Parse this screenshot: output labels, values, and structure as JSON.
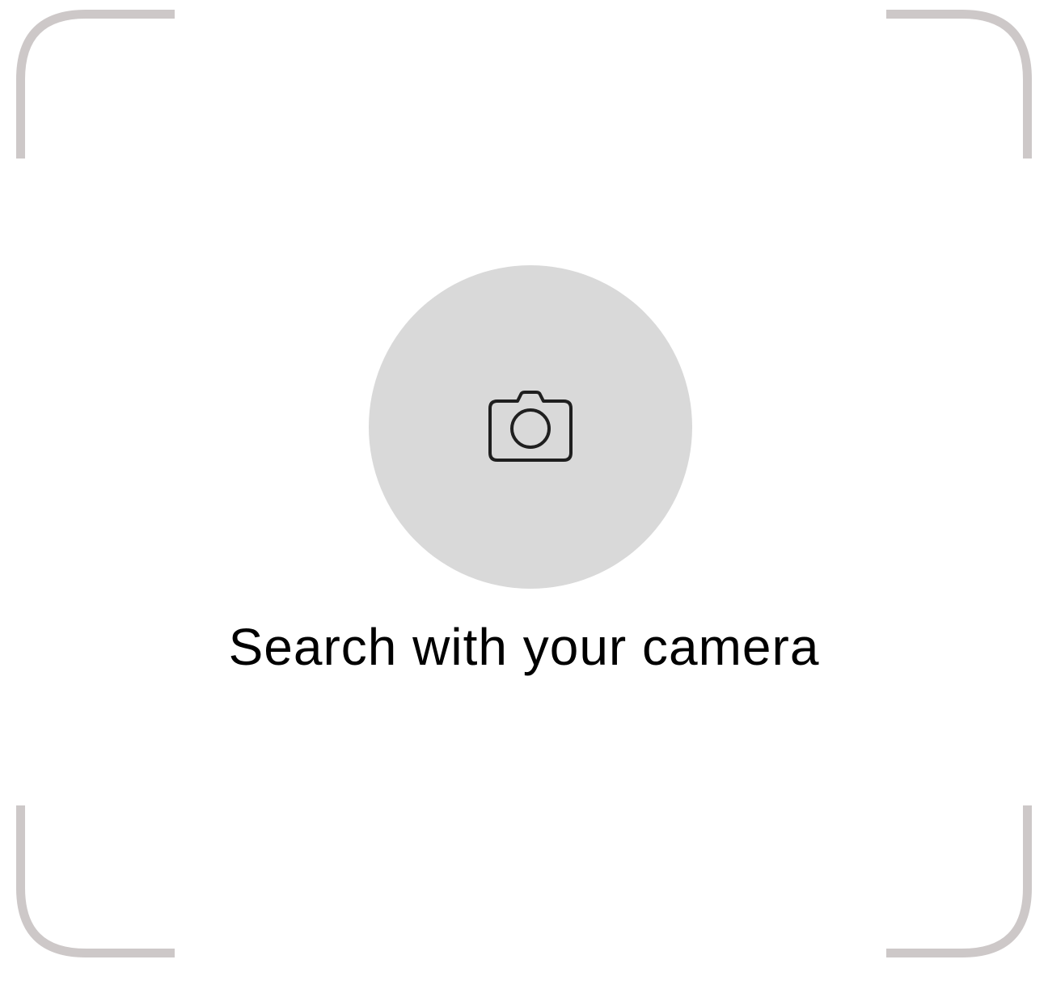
{
  "scanner": {
    "prompt_label": "Search with your camera",
    "frame_color": "#cdc8c8",
    "button_color": "#d9d9d9",
    "icon": "camera-icon"
  }
}
